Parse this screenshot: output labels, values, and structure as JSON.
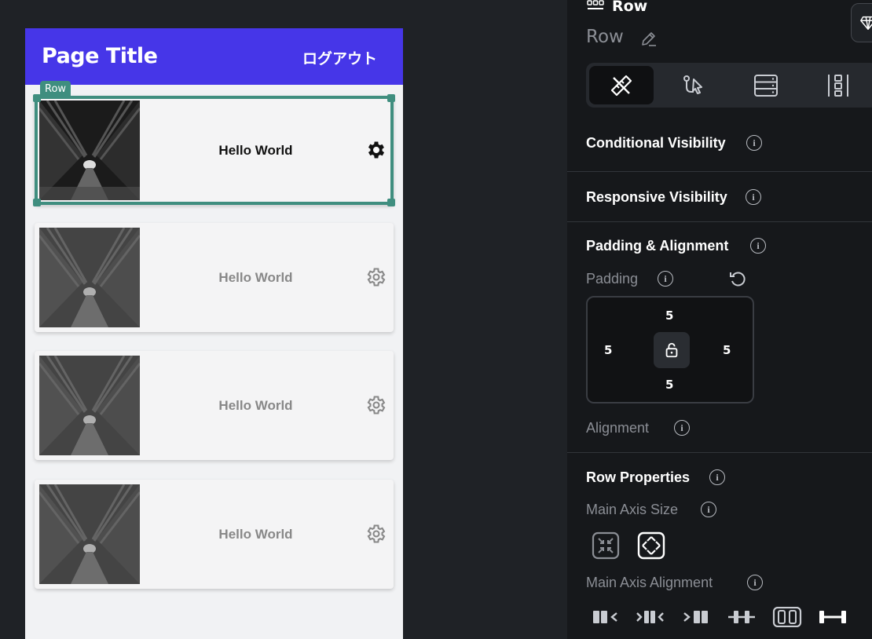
{
  "canvas": {
    "app_title": "Page Title",
    "logout_label": "ログアウト",
    "row_tag": "Row",
    "cards": [
      {
        "label": "Hello World",
        "selected": true
      },
      {
        "label": "Hello World",
        "selected": false
      },
      {
        "label": "Hello World",
        "selected": false
      },
      {
        "label": "Hello World",
        "selected": false
      }
    ]
  },
  "panel": {
    "widget_type": "Row",
    "widget_name": "Row",
    "sections": {
      "conditional_visibility": "Conditional Visibility",
      "responsive_visibility": "Responsive Visibility",
      "padding_alignment": "Padding & Alignment",
      "padding_label": "Padding",
      "alignment_label": "Alignment",
      "row_properties": "Row Properties",
      "main_axis_size": "Main Axis Size",
      "main_axis_alignment": "Main Axis Alignment"
    },
    "padding": {
      "top": "5",
      "left": "5",
      "right": "5",
      "bottom": "5"
    },
    "colors": {
      "accent": "#3f8e7f",
      "appbar": "#4636e8",
      "panel_bg": "#16181b"
    }
  }
}
